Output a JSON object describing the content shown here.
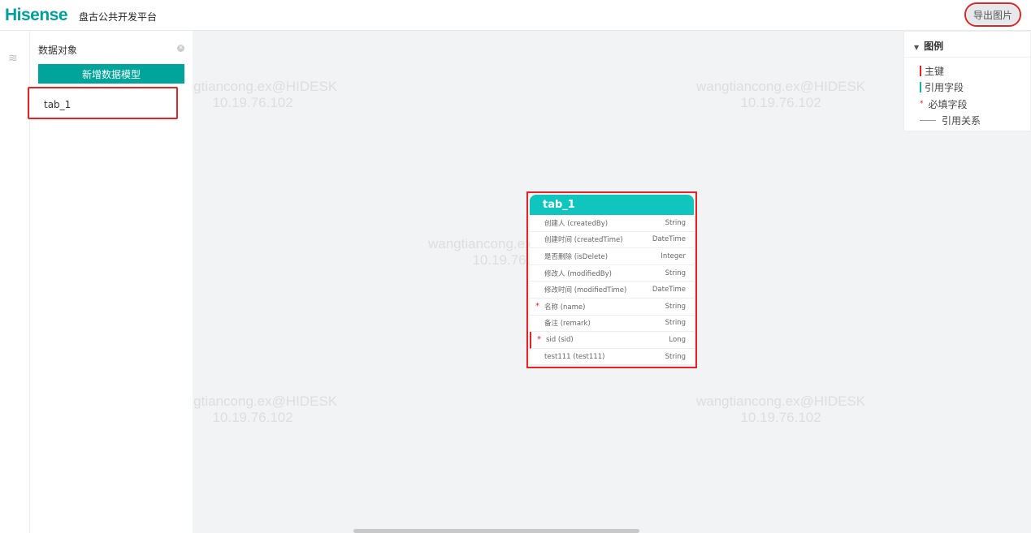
{
  "header": {
    "logo": "Hisense",
    "platform": "盘古公共开发平台",
    "export_label": "导出图片"
  },
  "panel": {
    "title": "数据对象",
    "add_label": "新增数据模型",
    "items": [
      "tab_1"
    ]
  },
  "watermark": {
    "line1": "wangtiancong.ex@HIDESK",
    "line2": "10.19.76.102"
  },
  "legend": {
    "title": "图例",
    "items": [
      {
        "label": "主键",
        "marker": "bar",
        "color": "#e62222"
      },
      {
        "label": "引用字段",
        "marker": "bar",
        "color": "#10b5ae"
      },
      {
        "label": "必填字段",
        "marker": "star",
        "color": "#e62222"
      },
      {
        "label": "引用关系",
        "marker": "line",
        "color": "#999999"
      }
    ]
  },
  "entity": {
    "name": "tab_1",
    "fields": [
      {
        "name": "创建人 (createdBy)",
        "type": "String",
        "required": false,
        "pk": false
      },
      {
        "name": "创建时间 (createdTime)",
        "type": "DateTime",
        "required": false,
        "pk": false
      },
      {
        "name": "是否删除 (isDelete)",
        "type": "Integer",
        "required": false,
        "pk": false
      },
      {
        "name": "修改人 (modifiedBy)",
        "type": "String",
        "required": false,
        "pk": false
      },
      {
        "name": "修改时间 (modifiedTime)",
        "type": "DateTime",
        "required": false,
        "pk": false
      },
      {
        "name": "名称 (name)",
        "type": "String",
        "required": true,
        "pk": false
      },
      {
        "name": "备注 (remark)",
        "type": "String",
        "required": false,
        "pk": false
      },
      {
        "name": "sid (sid)",
        "type": "Long",
        "required": true,
        "pk": true
      },
      {
        "name": "test111 (test111)",
        "type": "String",
        "required": false,
        "pk": false
      }
    ]
  },
  "colors": {
    "accent": "#00a49b",
    "entity_header": "#10c5be",
    "highlight": "#e62222"
  }
}
